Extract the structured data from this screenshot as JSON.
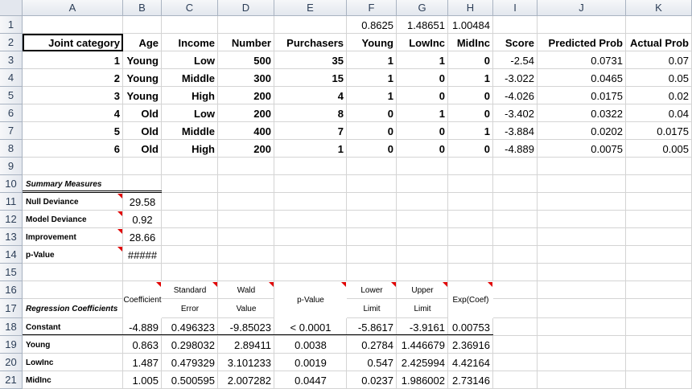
{
  "columns": [
    "A",
    "B",
    "C",
    "D",
    "E",
    "F",
    "G",
    "H",
    "I",
    "J",
    "K"
  ],
  "rows": [
    "1",
    "2",
    "3",
    "4",
    "5",
    "6",
    "7",
    "8",
    "9",
    "10",
    "11",
    "12",
    "13",
    "14",
    "15",
    "16",
    "17",
    "18",
    "19",
    "20",
    "21"
  ],
  "row1": {
    "F": "0.8625",
    "G": "1.48651",
    "H": "1.00484"
  },
  "headers": {
    "A": "Joint category",
    "B": "Age",
    "C": "Income",
    "D": "Number",
    "E": "Purchasers",
    "F": "Young",
    "G": "LowInc",
    "H": "MidInc",
    "I": "Score",
    "J": "Predicted Prob",
    "K": "Actual Prob"
  },
  "data_rows": [
    [
      "1",
      "Young",
      "Low",
      "500",
      "35",
      "1",
      "1",
      "0",
      "-2.54",
      "0.0731",
      "0.07"
    ],
    [
      "2",
      "Young",
      "Middle",
      "300",
      "15",
      "1",
      "0",
      "1",
      "-3.022",
      "0.0465",
      "0.05"
    ],
    [
      "3",
      "Young",
      "High",
      "200",
      "4",
      "1",
      "0",
      "0",
      "-4.026",
      "0.0175",
      "0.02"
    ],
    [
      "4",
      "Old",
      "Low",
      "200",
      "8",
      "0",
      "1",
      "0",
      "-3.402",
      "0.0322",
      "0.04"
    ],
    [
      "5",
      "Old",
      "Middle",
      "400",
      "7",
      "0",
      "0",
      "1",
      "-3.884",
      "0.0202",
      "0.0175"
    ],
    [
      "6",
      "Old",
      "High",
      "200",
      "1",
      "0",
      "0",
      "0",
      "-4.889",
      "0.0075",
      "0.005"
    ]
  ],
  "summary": {
    "title": "Summary Measures",
    "items": [
      {
        "label": "Null Deviance",
        "value": "29.58"
      },
      {
        "label": "Model Deviance",
        "value": "0.92"
      },
      {
        "label": "Improvement",
        "value": "28.66"
      },
      {
        "label": "p-Value",
        "value": "#####"
      }
    ]
  },
  "regression": {
    "title": "Regression Coefficients",
    "headers_top": {
      "B": "Coefficient",
      "C": "Standard",
      "D": "Wald",
      "F": "Lower",
      "G": "Upper"
    },
    "headers_bottom": {
      "C": "Error",
      "D": "Value",
      "F": "Limit",
      "G": "Limit"
    },
    "header_pvalue": "p-Value",
    "header_exp": "Exp(Coef)",
    "rows": [
      [
        "Constant",
        "-4.889",
        "0.496323",
        "-9.85023",
        "< 0.0001",
        "-5.8617",
        "-3.9161",
        "0.00753"
      ],
      [
        "Young",
        "0.863",
        "0.298032",
        "2.89411",
        "0.0038",
        "0.2784",
        "1.446679",
        "2.36916"
      ],
      [
        "LowInc",
        "1.487",
        "0.479329",
        "3.101233",
        "0.0019",
        "0.547",
        "2.425994",
        "4.42164"
      ],
      [
        "MidInc",
        "1.005",
        "0.500595",
        "2.007282",
        "0.0447",
        "0.0237",
        "1.986002",
        "2.73146"
      ]
    ]
  }
}
